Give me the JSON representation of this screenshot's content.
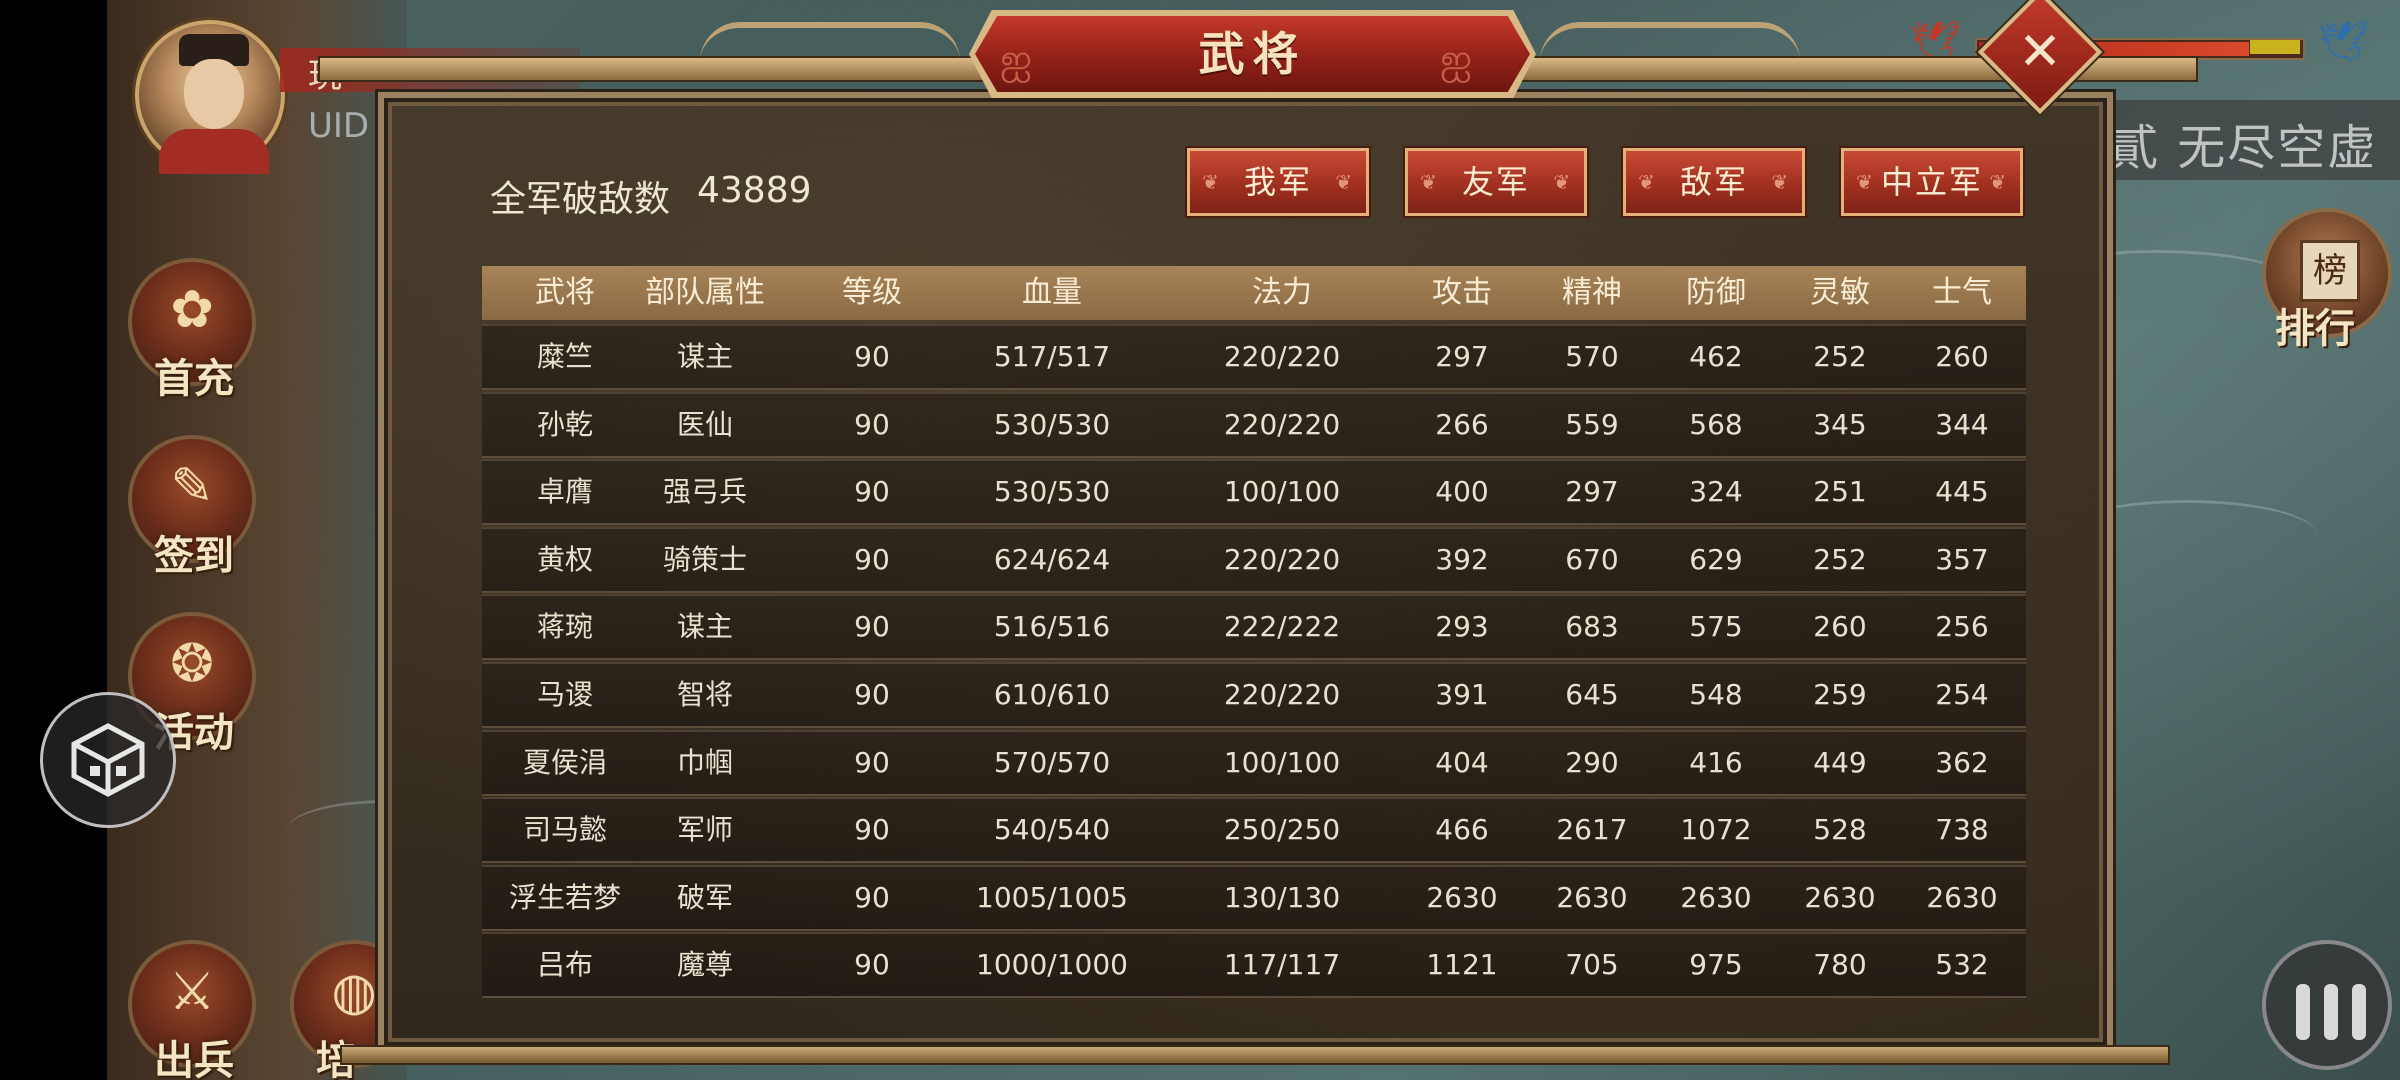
{
  "player": {
    "name": "玩",
    "uid_label": "UID"
  },
  "side_menu": {
    "first_charge": "首充",
    "sign_in": "签到",
    "events": "活动",
    "deploy": "出兵",
    "cultivate": "培"
  },
  "right_hud": {
    "banner": "貳 无尽空虚",
    "rank_label": "排行",
    "rank_glyph": "榜"
  },
  "dialog": {
    "title": "武将",
    "close_symbol": "✕",
    "kill_label": "全军破敌数",
    "kill_count": "43889",
    "tabs": [
      "我军",
      "友军",
      "敌军",
      "中立军"
    ]
  },
  "table": {
    "headers": [
      "武将",
      "部队属性",
      "等级",
      "血量",
      "法力",
      "攻击",
      "精神",
      "防御",
      "灵敏",
      "士气"
    ],
    "rows": [
      [
        "糜竺",
        "谋主",
        "90",
        "517/517",
        "220/220",
        "297",
        "570",
        "462",
        "252",
        "260"
      ],
      [
        "孙乾",
        "医仙",
        "90",
        "530/530",
        "220/220",
        "266",
        "559",
        "568",
        "345",
        "344"
      ],
      [
        "卓膺",
        "强弓兵",
        "90",
        "530/530",
        "100/100",
        "400",
        "297",
        "324",
        "251",
        "445"
      ],
      [
        "黄权",
        "骑策士",
        "90",
        "624/624",
        "220/220",
        "392",
        "670",
        "629",
        "252",
        "357"
      ],
      [
        "蒋琬",
        "谋主",
        "90",
        "516/516",
        "222/222",
        "293",
        "683",
        "575",
        "260",
        "256"
      ],
      [
        "马谡",
        "智将",
        "90",
        "610/610",
        "220/220",
        "391",
        "645",
        "548",
        "259",
        "254"
      ],
      [
        "夏侯涓",
        "巾帼",
        "90",
        "570/570",
        "100/100",
        "404",
        "290",
        "416",
        "449",
        "362"
      ],
      [
        "司马懿",
        "军师",
        "90",
        "540/540",
        "250/250",
        "466",
        "2617",
        "1072",
        "528",
        "738"
      ],
      [
        "浮生若梦",
        "破军",
        "90",
        "1005/1005",
        "130/130",
        "2630",
        "2630",
        "2630",
        "2630",
        "2630"
      ],
      [
        "吕布",
        "魔尊",
        "90",
        "1000/1000",
        "117/117",
        "1121",
        "705",
        "975",
        "780",
        "532"
      ]
    ]
  },
  "colors": {
    "accent_red": "#a1301f",
    "header_brown": "#a88358",
    "panel_dark": "#372e22",
    "gold_border": "#d8b985"
  }
}
